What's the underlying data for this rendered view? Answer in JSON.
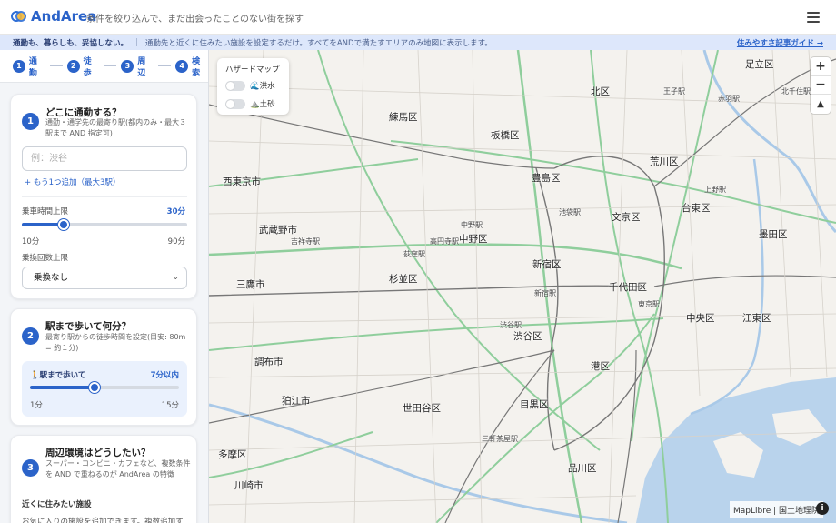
{
  "header": {
    "brand": "AndArea",
    "tagline": "条件を絞り込んで、まだ出会ったことのない街を探す"
  },
  "banner": {
    "strong": "通勤も、暮らしも、妥協しない。",
    "separator": "|",
    "text": "通勤先と近くに住みたい施設を設定するだけ。すべてをANDで満たすエリアのみ地図に表示します。",
    "link": "住みやすさ記事ガイド →"
  },
  "steps": [
    {
      "num": "1",
      "label": "通勤"
    },
    {
      "num": "2",
      "label": "徒歩"
    },
    {
      "num": "3",
      "label": "周辺"
    },
    {
      "num": "4",
      "label": "検索"
    }
  ],
  "commute": {
    "num": "1",
    "title": "どこに通勤する？",
    "desc": "通勤・通学先の最寄り駅(都内のみ・最大３駅まで AND 指定可)",
    "placeholder": "例：渋谷",
    "add_link": "+ もう1つ追加（最大3駅）",
    "time_label": "乗車時間上限",
    "time_value": "30分",
    "time_min": "10分",
    "time_max": "90分",
    "time_fraction": 0.25,
    "transfer_label": "乗換回数上限",
    "transfer_value": "乗換なし"
  },
  "walk": {
    "num": "2",
    "title": "駅まで歩いて何分？",
    "desc": "最寄り駅からの徒歩時間を設定(目安: 80m = 約１分)",
    "box_label": "🚶駅まで歩いて",
    "box_value": "7分以内",
    "min": "1分",
    "max": "15分",
    "fraction": 0.43
  },
  "surround": {
    "num": "3",
    "title": "周辺環境はどうしたい？",
    "desc": "スーパー・コンビニ・カフェなど、複数条件を AND で重ねるのが AndArea の特徴",
    "sub_heading": "近くに住みたい施設",
    "sub_desc": "お気に入りの施設を追加できます。複数追加す"
  },
  "hazard": {
    "title": "ハザードマップ",
    "flood": "🌊洪水",
    "landslide": "⛰️土砂"
  },
  "zoom": {
    "in": "+",
    "out": "−",
    "compass": "▲"
  },
  "attribution": "MapLibre | 国土地理院",
  "info": "i",
  "map_labels": [
    {
      "text": "足立区",
      "cls": "ward"
    },
    {
      "text": "北区",
      "cls": "ward"
    },
    {
      "text": "練馬区",
      "cls": "ward"
    },
    {
      "text": "板橋区",
      "cls": "ward"
    },
    {
      "text": "豊島区",
      "cls": "ward"
    },
    {
      "text": "荒川区",
      "cls": "ward"
    },
    {
      "text": "文京区",
      "cls": "ward"
    },
    {
      "text": "台東区",
      "cls": "ward"
    },
    {
      "text": "西東京市",
      "cls": "ward"
    },
    {
      "text": "武蔵野市",
      "cls": "ward"
    },
    {
      "text": "中野区",
      "cls": "ward"
    },
    {
      "text": "杉並区",
      "cls": "ward"
    },
    {
      "text": "新宿区",
      "cls": "ward"
    },
    {
      "text": "千代田区",
      "cls": "ward"
    },
    {
      "text": "墨田区",
      "cls": "ward"
    },
    {
      "text": "三鷹市",
      "cls": "ward"
    },
    {
      "text": "渋谷区",
      "cls": "ward"
    },
    {
      "text": "中央区",
      "cls": "ward"
    },
    {
      "text": "江東区",
      "cls": "ward"
    },
    {
      "text": "港区",
      "cls": "ward"
    },
    {
      "text": "調布市",
      "cls": "ward"
    },
    {
      "text": "狛江市",
      "cls": "ward"
    },
    {
      "text": "世田谷区",
      "cls": "ward"
    },
    {
      "text": "目黒区",
      "cls": "ward"
    },
    {
      "text": "品川区",
      "cls": "ward"
    },
    {
      "text": "多摩区",
      "cls": "ward"
    },
    {
      "text": "川崎市",
      "cls": "ward"
    },
    {
      "text": "赤羽駅",
      "cls": "station"
    },
    {
      "text": "王子駅",
      "cls": "station"
    },
    {
      "text": "池袋駅",
      "cls": "station"
    },
    {
      "text": "高円寺駅",
      "cls": "station"
    },
    {
      "text": "荻窪駅",
      "cls": "station"
    },
    {
      "text": "中野駅",
      "cls": "station"
    },
    {
      "text": "新宿駅",
      "cls": "station"
    },
    {
      "text": "東京駅",
      "cls": "station"
    },
    {
      "text": "渋谷駅",
      "cls": "station"
    },
    {
      "text": "三軒茶屋駅",
      "cls": "station"
    },
    {
      "text": "吉祥寺駅",
      "cls": "station"
    },
    {
      "text": "上野駅",
      "cls": "station"
    },
    {
      "text": "北千住駅",
      "cls": "station"
    }
  ]
}
